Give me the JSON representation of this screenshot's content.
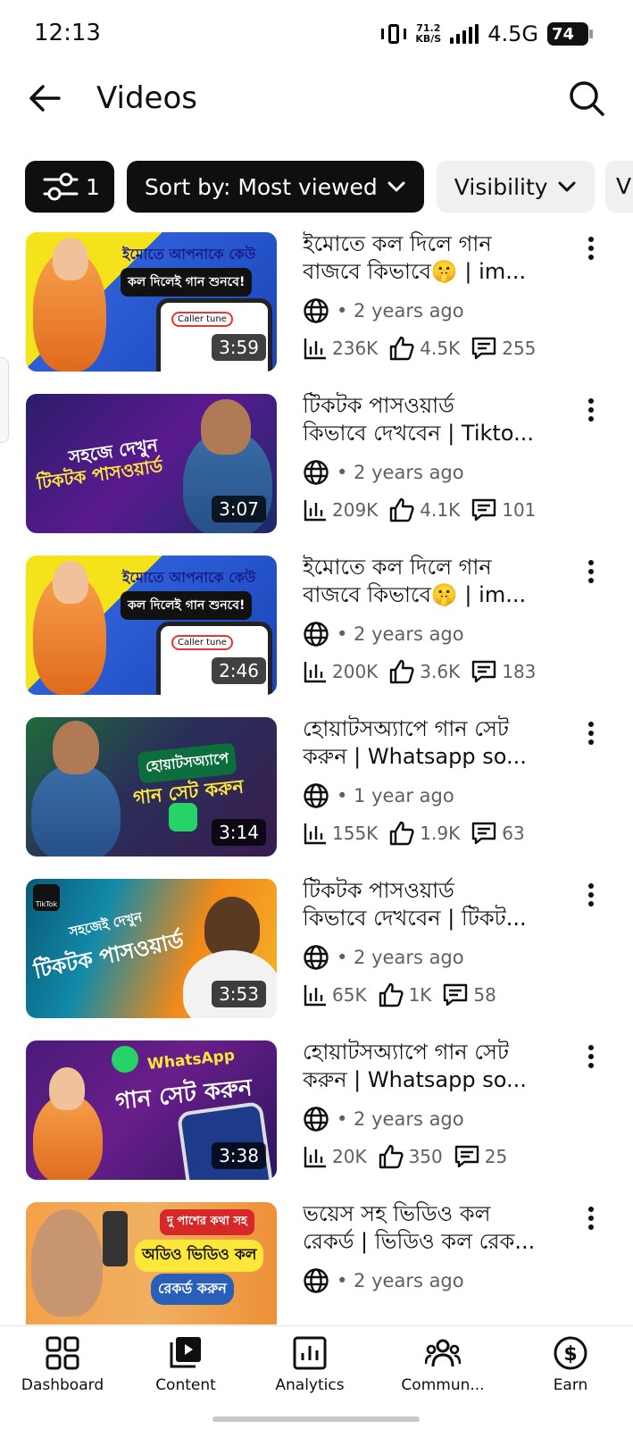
{
  "status_bar": {
    "time": "12:13",
    "net_speed_value": "71.2",
    "net_speed_unit": "KB/S",
    "network": "4.5G",
    "battery": "74"
  },
  "header": {
    "title": "Videos",
    "back_icon": "arrow-left-icon",
    "search_icon": "search-icon"
  },
  "filters": {
    "filter_count": "1",
    "sort_label": "Sort by: Most viewed",
    "visibility_label": "Visibility",
    "next_chip_partial": "V"
  },
  "videos": [
    {
      "title_line1": "ইমোতে কল দিলে গান",
      "title_line2": "বাজবে কিভাবে🤫 | im...",
      "age": "• 2 years ago",
      "views": "236K",
      "likes": "4.5K",
      "comments": "255",
      "duration": "3:59",
      "thumb_text1": "ইমোতে আপনাকে কেউ",
      "thumb_text2": "কল দিলেই গান শুনবে!",
      "thumb_text3": "Caller tune"
    },
    {
      "title_line1": "টিকটক পাসওয়ার্ড",
      "title_line2": "কিভাবে দেখবেন | Tikto...",
      "age": "• 2 years ago",
      "views": "209K",
      "likes": "4.1K",
      "comments": "101",
      "duration": "3:07",
      "thumb_text1": "সহজে দেখুন",
      "thumb_text2": "টিকটক পাসওয়ার্ড"
    },
    {
      "title_line1": "ইমোতে কল দিলে গান",
      "title_line2": "বাজবে কিভাবে🤫 | im...",
      "age": "• 2 years ago",
      "views": "200K",
      "likes": "3.6K",
      "comments": "183",
      "duration": "2:46",
      "thumb_text1": "ইমোতে আপনাকে কেউ",
      "thumb_text2": "কল দিলেই গান শুনবে!",
      "thumb_text3": "Caller tune"
    },
    {
      "title_line1": "হোয়াটসঅ্যাপে গান সেট",
      "title_line2": "করুন | Whatsapp so...",
      "age": "• 1 year ago",
      "views": "155K",
      "likes": "1.9K",
      "comments": "63",
      "duration": "3:14",
      "thumb_text1": "হোয়াটসঅ্যাপে",
      "thumb_text2": "গান সেট করুন"
    },
    {
      "title_line1": "টিকটক পাসওয়ার্ড",
      "title_line2": "কিভাবে দেখবেন | টিকট...",
      "age": "• 2 years ago",
      "views": "65K",
      "likes": "1K",
      "comments": "58",
      "duration": "3:53",
      "thumb_text1": "সহজেই দেখুন",
      "thumb_text2": "টিকটক পাসওয়ার্ড",
      "thumb_text3": "TikTok"
    },
    {
      "title_line1": "হোয়াটসঅ্যাপে গান সেট",
      "title_line2": "করুন | Whatsapp so...",
      "age": "• 2 years ago",
      "views": "20K",
      "likes": "350",
      "comments": "25",
      "duration": "3:38",
      "thumb_text1": "WhatsApp",
      "thumb_text2": "গান সেট করুন"
    },
    {
      "title_line1": "ভয়েস সহ ভিডিও কল",
      "title_line2": "রেকর্ড | ভিডিও কল রেক...",
      "age": "• 2 years ago",
      "thumb_text1": "দু পাশের কথা সহ",
      "thumb_text2": "অডিও ভিডিও কল",
      "thumb_text3": "রেকর্ড করুন"
    }
  ],
  "bottom_nav": [
    {
      "label": "Dashboard",
      "icon": "dashboard-icon"
    },
    {
      "label": "Content",
      "icon": "content-icon"
    },
    {
      "label": "Analytics",
      "icon": "analytics-icon"
    },
    {
      "label": "Commun...",
      "icon": "community-icon"
    },
    {
      "label": "Earn",
      "icon": "earn-icon"
    }
  ],
  "colors": {
    "chip_dark": "#0f0f0f",
    "chip_light": "#f0f0f0",
    "meta_gray": "#606060"
  }
}
